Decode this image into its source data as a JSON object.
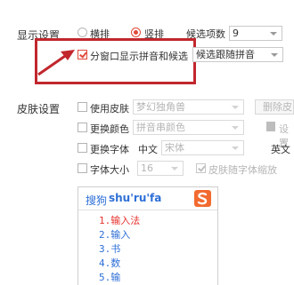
{
  "display_settings": {
    "label": "显示设置",
    "layout_options": [
      {
        "label": "横排",
        "selected": false
      },
      {
        "label": "竖排",
        "selected": true
      }
    ],
    "candidate_count_label": "候选项数",
    "candidate_count_value": "9",
    "split_window_label": "分窗口显示拼音和候选",
    "split_window_checked": true,
    "pinyin_follow_select": "候选跟随拼音"
  },
  "skin_settings": {
    "label": "皮肤设置",
    "use_skin_label": "使用皮肤",
    "use_skin_value": "梦幻独角兽",
    "delete_skin_button": "删除皮",
    "change_color_label": "更换颜色",
    "change_color_value": "拼音串颜色",
    "set_button": "设置",
    "change_font_label": "更换字体",
    "chinese_label": "中文",
    "chinese_font_value": "宋体",
    "english_label": "英文",
    "font_size_label": "字体大小",
    "font_size_value": "16",
    "scale_with_skin_label": "皮肤随字体缩放"
  },
  "preview": {
    "input_prefix": "搜狗",
    "input_pinyin": "shu'ru'fa",
    "candidates": [
      "1.输入法",
      "2.输入",
      "3.书",
      "4.数",
      "5.输"
    ]
  },
  "colors": {
    "accent": "#e14a3b",
    "annotation_box": "#c1272d",
    "candidate_first": "#e5322d",
    "candidate_other": "#2e6fd6",
    "preview_input": "#2e6fd6",
    "logo": "#f26a2f"
  }
}
